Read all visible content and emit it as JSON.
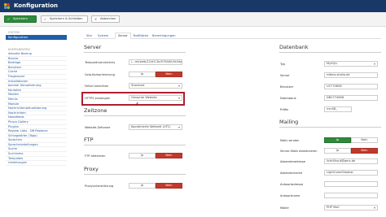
{
  "header": {
    "title": "Konfiguration",
    "logo_icon": "joomla-icon",
    "bar_color": "#1a3867"
  },
  "toolbar": {
    "save": "Speichern",
    "save_close": "Speichern & Schließen",
    "cancel": "Abbrechen"
  },
  "sidebar": {
    "system_heading": "SYSTEM",
    "active": "Konfiguration",
    "components_heading": "KOMPONENTEN",
    "items": [
      "Aktuelle Backup",
      "Banner",
      "Beiträge",
      "Benutzer",
      "Cache",
      "Fragenpost",
      "Installationen",
      "Joomla! Aktualisierung",
      "Kontakte",
      "Medien",
      "Menüs",
      "Module",
      "Nachrichtenaktualisierung",
      "Nachrichten",
      "Newsfeeds",
      "Phoca Gallery",
      "Plugins",
      "Regular Labs - DB Replacer",
      "Schlagwörter (Tags)",
      "Sprachen",
      "Spracheinstellungen",
      "Suche",
      "Suchindex",
      "Templates",
      "Umleitungen"
    ]
  },
  "tabs": [
    "Site",
    "System",
    "Server",
    "TextBlöcke",
    "Berechtigungen"
  ],
  "server": {
    "heading": "Server",
    "rows": {
      "temp_label": "Temporärverzeichnis",
      "temp_value": "/...mt/web/12/d1/1b/576440/ht/ktor",
      "gzip_label": "Gzip-Komprimierung",
      "gzip_yes": "Ja",
      "gzip_no": "Nein",
      "errors_label": "Fehler berichten",
      "errors_value": "Standard",
      "https_label": "HTTPS erzwingen",
      "https_value": "Gesamte Website"
    }
  },
  "zeitzone": {
    "heading": "Zeitzone",
    "label": "Website-Zeitzone",
    "value": "Koordinierte Weltzeit (UTC)"
  },
  "ftp": {
    "heading": "FTP",
    "label": "FTP aktivieren",
    "yes": "Ja",
    "no": "Nein"
  },
  "proxy": {
    "heading": "Proxy",
    "label": "Proxyunterstützung",
    "yes": "Ja",
    "no": "Nein"
  },
  "datenbank": {
    "heading": "Datenbank",
    "typ_label": "Typ",
    "typ_value": "MySQLi",
    "server_label": "Server",
    "server_value": "rdbms.strato.de",
    "user_label": "Benutzer",
    "user_value": "U2774856",
    "db_label": "Datenbank",
    "db_value": "DB2774856",
    "prefix_label": "Präfix",
    "prefix_value": "nvn08_"
  },
  "mailing": {
    "heading": "Mailing",
    "send_label": "Mails senden",
    "send_yes": "Ja",
    "send_no": "Nein",
    "disable_label": "Server-Mails deaktivieren",
    "disable_yes": "Ja",
    "disable_no": "Nein",
    "from_addr_label": "Absenderadresse",
    "from_addr_value": "lichtShout@gmx.de",
    "from_name_label": "Absendername",
    "from_name_value": "LightColorShadow",
    "reply_label": "Antwortadresse",
    "reply_value": "",
    "reply_name_label": "Antwortname",
    "reply_name_value": "",
    "mailer_label": "Mailer",
    "mailer_value": "PHP Mail"
  },
  "colors": {
    "accent": "#1f5ea8",
    "green": "#2f8a3c",
    "red": "#c0392b",
    "highlight": "#b01d2e"
  }
}
